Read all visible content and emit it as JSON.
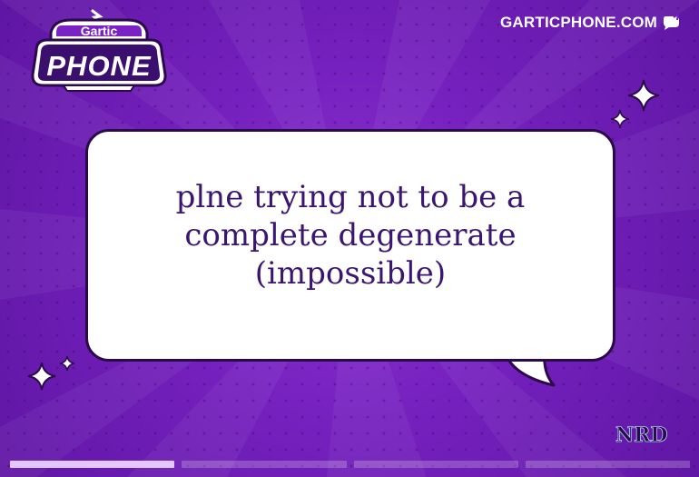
{
  "header": {
    "logo_top": "Gartic",
    "logo_bottom": "PHONE",
    "site_label": "GARTICPHONE.COM",
    "site_icon": "speech-bubble-icon"
  },
  "card": {
    "text": "plne trying not to be a complete degenerate (impossible)",
    "author": "NRD"
  },
  "progress": {
    "total": 4,
    "current": 1,
    "segments": [
      {
        "state": "active"
      },
      {
        "state": "inactive"
      },
      {
        "state": "inactive"
      },
      {
        "state": "inactive"
      }
    ]
  },
  "colors": {
    "background": "#7420bd",
    "bubble": "#ffffff",
    "text": "#3a1670",
    "progress_active": "#e3c8ff"
  }
}
